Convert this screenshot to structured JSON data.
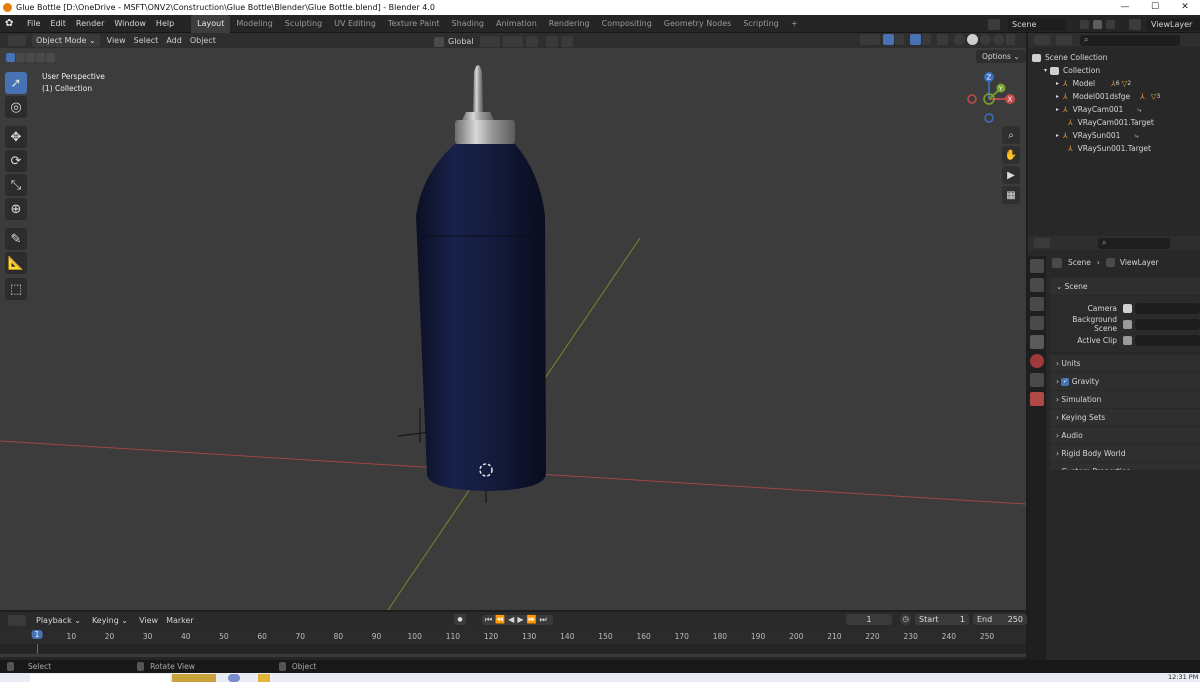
{
  "window": {
    "title": "Glue Bottle [D:\\OneDrive - MSFT\\ONV2\\Construction\\Glue Bottle\\Blender\\Glue Bottle.blend] - Blender 4.0"
  },
  "menus": [
    "File",
    "Edit",
    "Render",
    "Window",
    "Help"
  ],
  "workspaces": [
    "Layout",
    "Modeling",
    "Sculpting",
    "UV Editing",
    "Texture Paint",
    "Shading",
    "Animation",
    "Rendering",
    "Compositing",
    "Geometry Nodes",
    "Scripting"
  ],
  "workspace_add": "+",
  "scene_selector": {
    "label": "Scene",
    "view_layer": "ViewLayer"
  },
  "viewport_header": {
    "mode": "Object Mode",
    "menus": [
      "View",
      "Select",
      "Add",
      "Object"
    ],
    "orientation": "Global",
    "options": "Options"
  },
  "viewport": {
    "view_name": "User Perspective",
    "collection": "(1) Collection",
    "gizmo": {
      "x": "X",
      "y": "Y",
      "z": "Z"
    }
  },
  "outliner": {
    "root": "Scene Collection",
    "collection": "Collection",
    "items": [
      {
        "name": "Model",
        "badge": "6",
        "badge2": "2"
      },
      {
        "name": "Model001dsfge",
        "badge": "3"
      },
      {
        "name": "VRayCam001",
        "badge": ""
      },
      {
        "name": "VRayCam001.Target",
        "badge": ""
      },
      {
        "name": "VRaySun001",
        "badge": ""
      },
      {
        "name": "VRaySun001.Target",
        "badge": ""
      }
    ]
  },
  "properties": {
    "breadcrumb": {
      "scene": "Scene",
      "view_layer": "ViewLayer"
    },
    "section": "Scene",
    "fields": {
      "camera": "Camera",
      "background_scene": "Background Scene",
      "active_clip": "Active Clip"
    },
    "panels": [
      "Units",
      "Gravity",
      "Simulation",
      "Keying Sets",
      "Audio",
      "Rigid Body World",
      "Custom Properties"
    ]
  },
  "timeline": {
    "menus": [
      "Playback",
      "Keying",
      "View",
      "Marker"
    ],
    "current_frame": "1",
    "start_label": "Start",
    "start": "1",
    "end_label": "End",
    "end": "250",
    "ticks": [
      "1",
      "10",
      "20",
      "30",
      "40",
      "50",
      "60",
      "70",
      "80",
      "90",
      "100",
      "110",
      "120",
      "130",
      "140",
      "150",
      "160",
      "170",
      "180",
      "190",
      "200",
      "210",
      "220",
      "230",
      "240",
      "250"
    ]
  },
  "status": {
    "select": "Select",
    "rotate": "Rotate View",
    "object": "Object",
    "clock": "12:31 PM"
  },
  "colors": {
    "accent": "#4772b3",
    "bottle": "#141a3a",
    "axis_x": "#b04a4a",
    "axis_y": "#7a9a2e"
  }
}
